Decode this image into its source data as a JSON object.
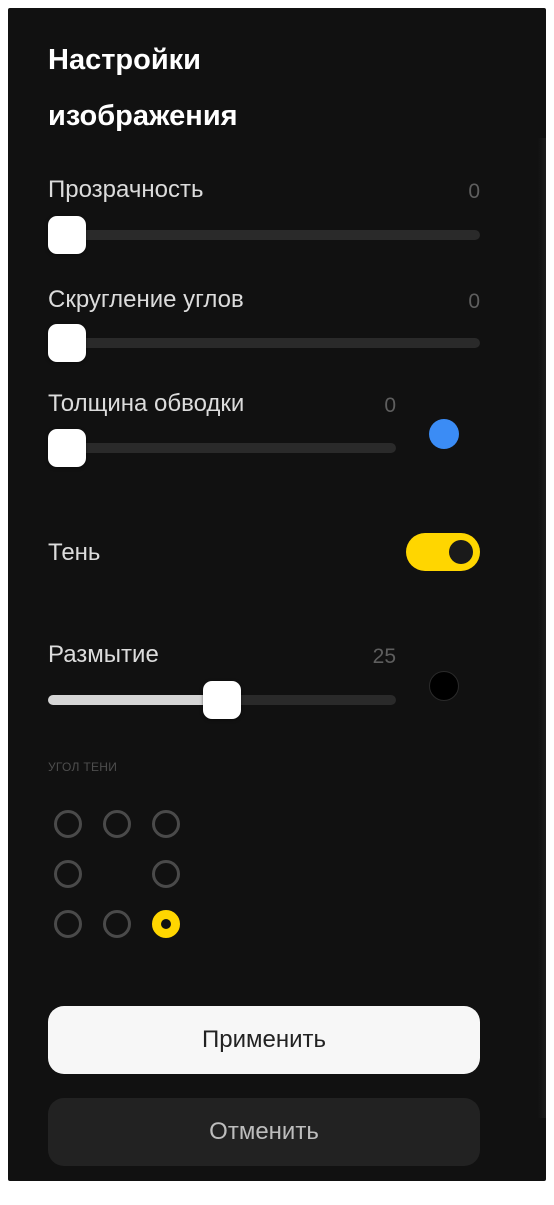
{
  "panel": {
    "title": "Настройки изображения"
  },
  "opacity": {
    "label": "Прозрачность",
    "value": "0",
    "fraction": 0
  },
  "corner_radius": {
    "label": "Скругление углов",
    "value": "0",
    "fraction": 0
  },
  "stroke_width": {
    "label": "Толщина обводки",
    "value": "0",
    "fraction": 0,
    "color": "#3b8cf5"
  },
  "shadow": {
    "label": "Тень",
    "enabled": true,
    "toggle_color": "#ffd600"
  },
  "blur": {
    "label": "Размытие",
    "value": "25",
    "fraction": 0.5,
    "color": "#000000"
  },
  "shadow_angle": {
    "label": "УГОЛ ТЕНИ",
    "selected": "bottom-right",
    "options": [
      "top-left",
      "top",
      "top-right",
      "left",
      "right",
      "bottom-left",
      "bottom",
      "bottom-right"
    ]
  },
  "buttons": {
    "apply": "Применить",
    "cancel": "Отменить"
  }
}
